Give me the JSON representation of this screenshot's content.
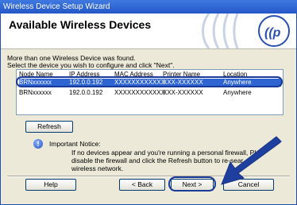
{
  "window": {
    "title": "Wireless Device Setup Wizard"
  },
  "header": {
    "title": "Available Wireless Devices"
  },
  "messages": {
    "line1": "More than one Wireless Device was found.",
    "line2": "Select the device you wish to configure and click \"Next\"."
  },
  "table": {
    "columns": [
      "Node Name",
      "IP Address",
      "MAC Address",
      "Printer Name",
      "Location"
    ],
    "rows": [
      {
        "node": "BRNxxxxxx",
        "ip": "192.0.0.192",
        "mac": "XXXXXXXXXXXX",
        "printer": "XXX-XXXXXX",
        "location": "Anywhere",
        "selected": true
      },
      {
        "node": "BRNxxxxxx",
        "ip": "192.0.0.192",
        "mac": "XXXXXXXXXXXX",
        "printer": "XXX-XXXXXX",
        "location": "Anywhere",
        "selected": false
      }
    ]
  },
  "buttons": {
    "refresh": "Refresh",
    "help": "Help",
    "back": "< Back",
    "next": "Next >",
    "cancel": "Cancel"
  },
  "notice": {
    "title": "Important Notice:",
    "line1": "If no devices appear and you're running a personal firewall, Plea",
    "line2": "disable the firewall and click the Refresh button to re-sear",
    "line3": "wireless network."
  },
  "colors": {
    "selection": "#2f64d3",
    "annotation": "#1a3a9a",
    "titlebar": "#2457c8"
  },
  "icons": {
    "notice": "info-icon",
    "header": "wireless-signal-icon"
  }
}
